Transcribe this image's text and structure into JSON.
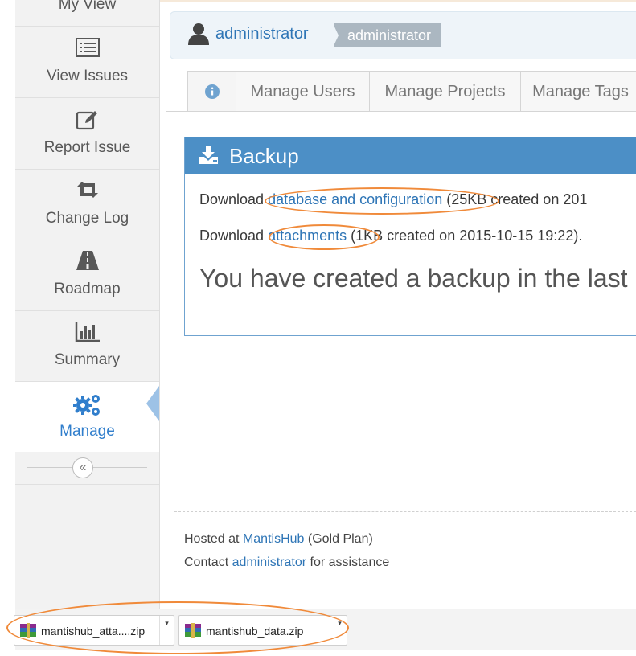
{
  "sidebar": {
    "items": [
      {
        "label": "My View",
        "icon": "dashboard-icon"
      },
      {
        "label": "View Issues",
        "icon": "list-icon"
      },
      {
        "label": "Report Issue",
        "icon": "edit-icon"
      },
      {
        "label": "Change Log",
        "icon": "retweet-icon"
      },
      {
        "label": "Roadmap",
        "icon": "road-icon"
      },
      {
        "label": "Summary",
        "icon": "bar-chart-icon"
      },
      {
        "label": "Manage",
        "icon": "gears-icon",
        "active": true
      }
    ],
    "collapse_glyph": "«"
  },
  "breadcrumb": {
    "user": "administrator",
    "role": "administrator"
  },
  "tabs": [
    {
      "label": "Manage Users"
    },
    {
      "label": "Manage Projects"
    },
    {
      "label": "Manage Tags"
    }
  ],
  "backup": {
    "title": "Backup",
    "row1": {
      "prefix": "Download ",
      "link": "database and configuration",
      "suffix": " (25KB created on 201"
    },
    "row2": {
      "prefix": "Download ",
      "link": "attachments",
      "suffix": " (1KB created on 2015-10-15 19:22)."
    },
    "notice": "You have created a backup in the last r"
  },
  "footer": {
    "hosted_prefix": "Hosted at ",
    "hosted_link": "MantisHub",
    "hosted_suffix": " (Gold Plan)",
    "contact_prefix": "Contact ",
    "contact_link": "administrator",
    "contact_suffix": " for assistance"
  },
  "downloads": [
    {
      "name": "mantishub_atta....zip"
    },
    {
      "name": "mantishub_data.zip"
    }
  ],
  "colors": {
    "accent": "#307ecc",
    "header": "#4c8fc6",
    "highlight": "#f08a3a"
  }
}
